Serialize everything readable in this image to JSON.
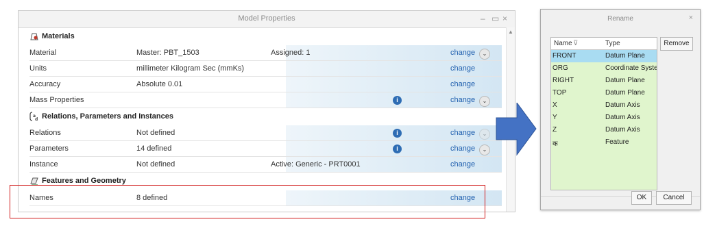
{
  "model_properties": {
    "title": "Model Properties",
    "controls": {
      "minimize": "–",
      "maximize": "▭",
      "close": "×"
    },
    "sections": [
      {
        "header": "Materials",
        "rows": [
          {
            "name": "Material",
            "value": "Master: PBT_1503",
            "extra": "Assigned: 1",
            "change": "change",
            "info": false,
            "expand": true
          },
          {
            "name": "Units",
            "value": "millimeter Kilogram Sec (mmKs)",
            "extra": "",
            "change": "change",
            "info": false,
            "expand": false
          },
          {
            "name": "Accuracy",
            "value": "Absolute 0.01",
            "extra": "",
            "change": "change",
            "info": false,
            "expand": false
          },
          {
            "name": "Mass Properties",
            "value": "",
            "extra": "",
            "change": "change",
            "info": true,
            "expand": true
          }
        ]
      },
      {
        "header": "Relations, Parameters and Instances",
        "rows": [
          {
            "name": "Relations",
            "value": "Not defined",
            "extra": "",
            "change": "change",
            "info": true,
            "expand": true
          },
          {
            "name": "Parameters",
            "value": "14 defined",
            "extra": "",
            "change": "change",
            "info": true,
            "expand": true
          },
          {
            "name": "Instance",
            "value": "Not defined",
            "extra": "Active: Generic - PRT0001",
            "change": "change",
            "info": false,
            "expand": false
          }
        ]
      },
      {
        "header": "Features and Geometry",
        "rows": [
          {
            "name": "Names",
            "value": "8 defined",
            "extra": "",
            "change": "change",
            "info": false,
            "expand": false
          }
        ]
      }
    ],
    "info_glyph": "i",
    "expand_glyph": "⌄"
  },
  "rename_dialog": {
    "title": "Rename",
    "close": "×",
    "columns": {
      "name": "Name",
      "type": "Type"
    },
    "filter_glyph": "⊽",
    "items": [
      {
        "name": "FRONT",
        "type": "Datum Plane",
        "selected": true
      },
      {
        "name": "ORG",
        "type": "Coordinate System",
        "selected": false
      },
      {
        "name": "RIGHT",
        "type": "Datum Plane",
        "selected": false
      },
      {
        "name": "TOP",
        "type": "Datum Plane",
        "selected": false
      },
      {
        "name": "X",
        "type": "Datum Axis",
        "selected": false
      },
      {
        "name": "Y",
        "type": "Datum Axis",
        "selected": false
      },
      {
        "name": "Z",
        "type": "Datum Axis",
        "selected": false
      },
      {
        "name": "क",
        "type": "Feature",
        "selected": false
      }
    ],
    "remove_label": "Remove",
    "ok_label": "OK",
    "cancel_label": "Cancel"
  },
  "colors": {
    "highlight_frame": "#d01818",
    "arrow": "#4472c4",
    "link": "#1f5fae",
    "table_bg": "#e0f5cd",
    "selected_row": "#a9dcf2"
  }
}
